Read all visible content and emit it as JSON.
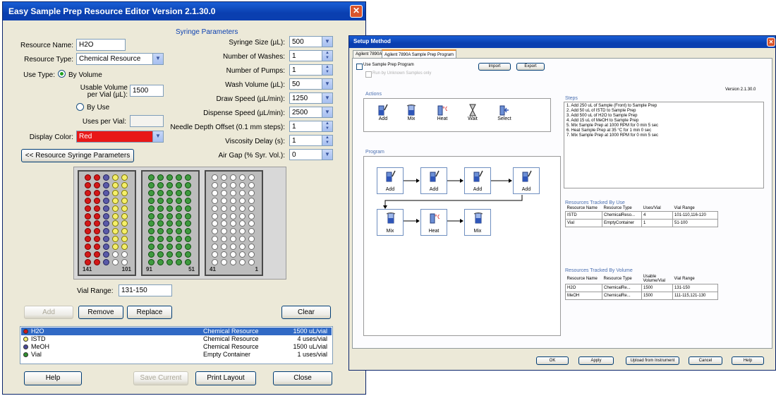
{
  "editor": {
    "title": "Easy Sample Prep Resource Editor Version 2.1.30.0",
    "syringe_section_title": "Syringe Parameters",
    "resource_name_label": "Resource Name:",
    "resource_name_value": "H2O",
    "resource_type_label": "Resource Type:",
    "resource_type_value": "Chemical Resource",
    "use_type_label": "Use Type:",
    "by_volume_label": "By Volume",
    "usable_volume_label_1": "Usable Volume",
    "usable_volume_label_2": "per Vial (µL):",
    "usable_volume_value": "1500",
    "by_use_label": "By Use",
    "uses_per_vial_label": "Uses per Vial:",
    "uses_per_vial_value": "",
    "display_color_label": "Display Color:",
    "display_color_value": "Red",
    "syringe_params_button": "<< Resource Syringe Parameters",
    "syringe_params": [
      {
        "label": "Syringe Size (µL):",
        "value": "500",
        "control": "dropdown"
      },
      {
        "label": "Number of Washes:",
        "value": "1",
        "control": "spin"
      },
      {
        "label": "Number of Pumps:",
        "value": "1",
        "control": "spin"
      },
      {
        "label": "Wash Volume (µL):",
        "value": "50",
        "control": "dropdown"
      },
      {
        "label": "Draw Speed (µL/min):",
        "value": "1250",
        "control": "dropdown"
      },
      {
        "label": "Dispense Speed (µL/min):",
        "value": "2500",
        "control": "dropdown"
      },
      {
        "label": "Needle Depth Offset (0.1 mm steps):",
        "value": "1",
        "control": "spin"
      },
      {
        "label": "Viscosity Delay (s):",
        "value": "1",
        "control": "spin"
      },
      {
        "label": "Air Gap (% Syr. Vol.):",
        "value": "0",
        "control": "dropdown"
      }
    ],
    "racks": [
      {
        "left_num": "141",
        "right_num": "101"
      },
      {
        "left_num": "91",
        "right_num": "51"
      },
      {
        "left_num": "41",
        "right_num": "1"
      }
    ],
    "vial_range_label": "Vial Range:",
    "vial_range_value": "131-150",
    "buttons": {
      "add": "Add",
      "remove": "Remove",
      "replace": "Replace",
      "clear": "Clear",
      "help": "Help",
      "save_current": "Save Current",
      "print_layout": "Print Layout",
      "close": "Close"
    },
    "resources": [
      {
        "name": "H2O",
        "type": "Chemical Resource",
        "amount": "1500 uL/vial",
        "color": "#d31818",
        "selected": true
      },
      {
        "name": "ISTD",
        "type": "Chemical Resource",
        "amount": "4 uses/vial",
        "color": "#f4ef6a",
        "selected": false
      },
      {
        "name": "MeOH",
        "type": "Chemical Resource",
        "amount": "1500 uL/vial",
        "color": "#4a4a9a",
        "selected": false
      },
      {
        "name": "Vial",
        "type": "Empty Container",
        "amount": "1 uses/vial",
        "color": "#2f8f2f",
        "selected": false
      }
    ]
  },
  "setup": {
    "title": "Setup Method",
    "tabs": [
      "Agilent 7890A",
      "Agilent 7890A Sample Prep Program"
    ],
    "use_program_label": "Use Sample Prep Program",
    "run_unknown_label": "Run by Unknown Samples only",
    "import_button": "Import",
    "export_button": "Export",
    "version": "Version 2.1.30.0",
    "actions_title": "Actions",
    "actions": [
      {
        "label": "Add",
        "icon": "syringe-icon"
      },
      {
        "label": "Mix",
        "icon": "mix-vial-icon"
      },
      {
        "label": "Heat",
        "icon": "heat-icon"
      },
      {
        "label": "Wait",
        "icon": "hourglass-icon"
      },
      {
        "label": "Select",
        "icon": "select-icon"
      }
    ],
    "program_title": "Program",
    "program_row1": [
      "Add",
      "Add",
      "Add",
      "Add"
    ],
    "program_row2": [
      "Mix",
      "Heat",
      "Mix"
    ],
    "steps_title": "Steps",
    "steps": [
      "1. Add 250 uL of Sample (Front) to Sample Prep",
      "2. Add 50 uL of ISTD to Sample Prep",
      "3. Add 500 uL of H2O to Sample Prep",
      "4. Add 15 uL of MeOH to Sample Prep",
      "5. Mix Sample Prep at 1000 RPM for 0 min 5 sec",
      "6. Heat Sample Prep at 35 °C for 1 min 0 sec",
      "7. Mix Sample Prep at 1000 RPM for 0 min 5 sec"
    ],
    "by_use_title": "Resources Tracked By Use",
    "by_use_headers": [
      "Resource Name",
      "Resource Type",
      "Uses/Vial",
      "Vial Range"
    ],
    "by_use_rows": [
      [
        "ISTD",
        "ChemicalReso...",
        "4",
        "101-110,116-120"
      ],
      [
        "Vial",
        "EmptyContainer",
        "1",
        "51-100"
      ]
    ],
    "by_volume_title": "Resources Tracked By Volume",
    "by_volume_headers": [
      "Resource Name",
      "Resource Type",
      "Usable Volume/Vial",
      "Vial Range"
    ],
    "by_volume_rows": [
      [
        "H2O",
        "ChemicalRe...",
        "1500",
        "131-150"
      ],
      [
        "MeOH",
        "ChemicalRe...",
        "1500",
        "111-115,121-130"
      ]
    ],
    "footer_buttons": [
      "OK",
      "Apply",
      "Upload from Instrument",
      "Cancel",
      "Help"
    ]
  }
}
